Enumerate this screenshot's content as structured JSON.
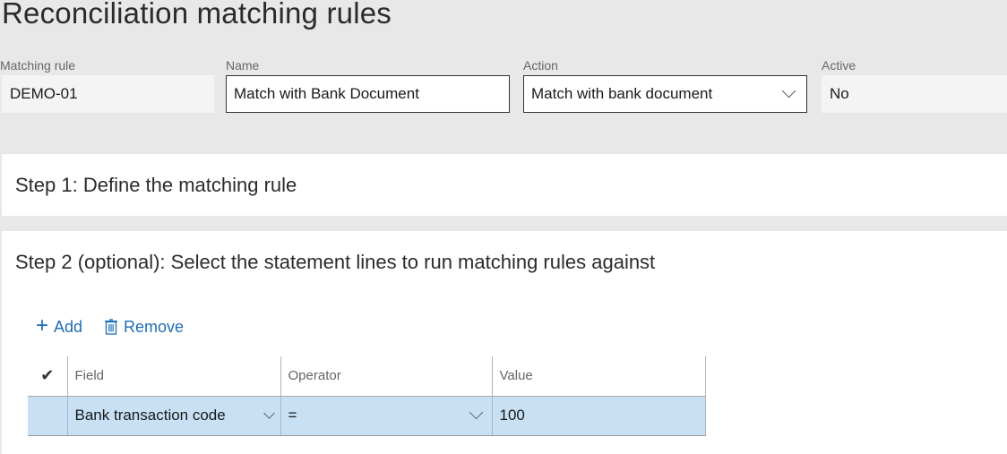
{
  "page": {
    "title": "Reconciliation matching rules"
  },
  "header_fields": {
    "matching_rule": {
      "label": "Matching rule",
      "value": "DEMO-01"
    },
    "name": {
      "label": "Name",
      "value": "Match with Bank Document"
    },
    "action": {
      "label": "Action",
      "value": "Match with bank document"
    },
    "active": {
      "label": "Active",
      "value": "No"
    }
  },
  "step1": {
    "title": "Step 1: Define the matching rule"
  },
  "step2": {
    "title": "Step 2 (optional): Select the statement lines to run matching rules against",
    "toolbar": {
      "add_label": "Add",
      "remove_label": "Remove",
      "add_icon": "plus-icon",
      "remove_icon": "trash-icon"
    },
    "grid": {
      "columns": [
        "Field",
        "Operator",
        "Value"
      ],
      "rows": [
        {
          "selected": true,
          "field": "Bank transaction code",
          "operator": "=",
          "value": "100"
        }
      ],
      "selected_row_color": "#c8e0f4"
    }
  },
  "colors": {
    "accent": "#1e6eb5",
    "page_background": "#e8e8e8"
  }
}
